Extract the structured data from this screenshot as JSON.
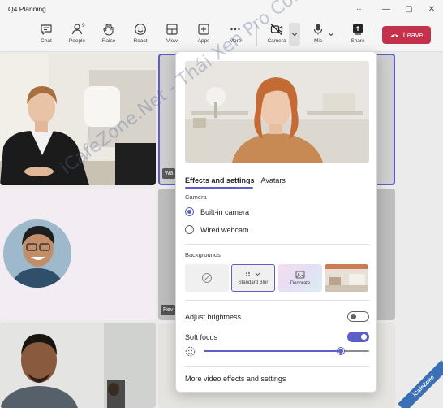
{
  "window": {
    "title": "Q4 Planning"
  },
  "toolbar": {
    "chat": "Chat",
    "people": "People",
    "people_count": "9",
    "raise": "Raise",
    "react": "React",
    "view": "View",
    "apps": "Apps",
    "more": "More",
    "camera": "Camera",
    "mic": "Mic",
    "share": "Share",
    "leave": "Leave"
  },
  "tiles": {
    "tile_label_1": "Wa",
    "tile_label_2": "Rev"
  },
  "popup": {
    "tabs": [
      "Effects and settings",
      "Avatars"
    ],
    "camera_section": "Camera",
    "camera_options": [
      "Built-in camera",
      "Wired webcam"
    ],
    "selected_camera": "Built-in camera",
    "backgrounds_section": "Backgrounds",
    "backgrounds": [
      "Standard Blur",
      "Decorate"
    ],
    "adjust_brightness": "Adjust brightness",
    "adjust_brightness_on": false,
    "soft_focus": "Soft focus",
    "soft_focus_on": true,
    "soft_focus_level": 0.83,
    "more_link": "More video effects and settings"
  },
  "watermark": "iCafeZone.Net - Thái Xen Pro Community",
  "corner_badge": "iCafeZone",
  "colors": {
    "accent": "#5b5fc7",
    "leave": "#c4314b"
  }
}
